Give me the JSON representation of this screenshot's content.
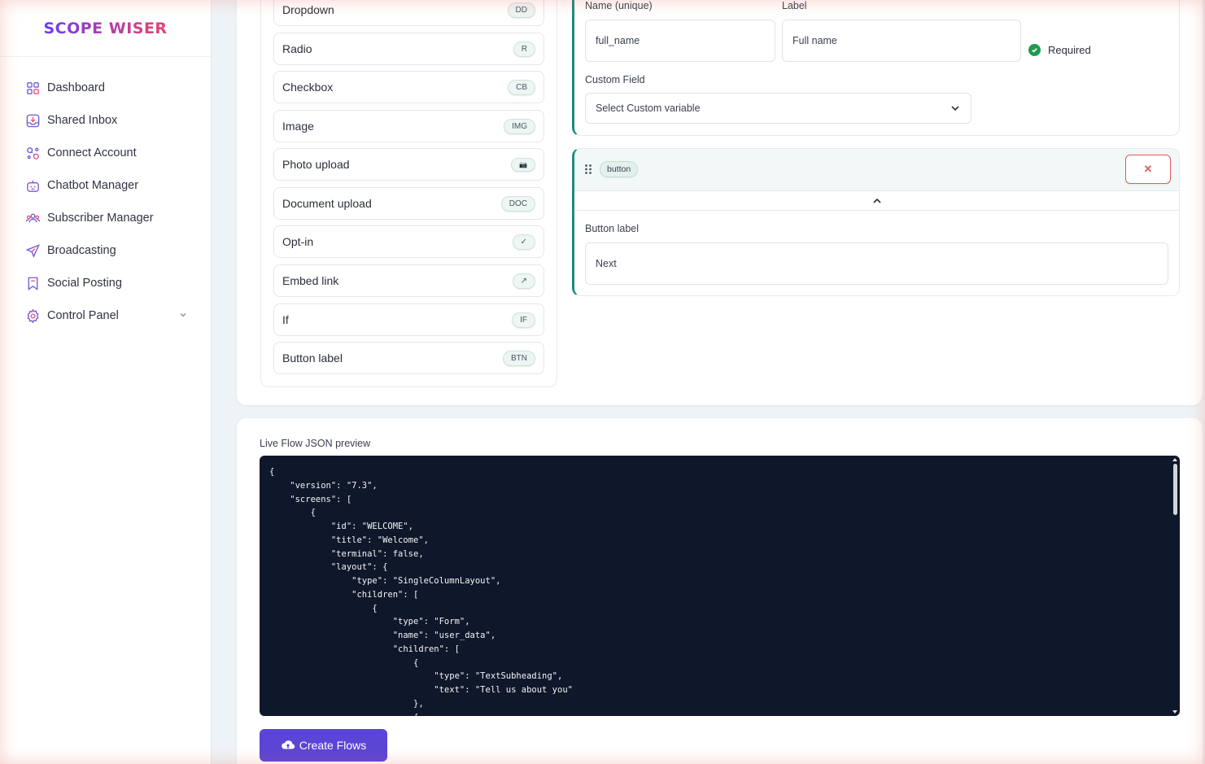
{
  "brand": {
    "logo_text": "SCOPE WISER"
  },
  "sidebar": {
    "items": [
      {
        "label": "Dashboard",
        "icon": "grid-icon"
      },
      {
        "label": "Shared Inbox",
        "icon": "inbox-icon"
      },
      {
        "label": "Connect Account",
        "icon": "link-icon"
      },
      {
        "label": "Chatbot Manager",
        "icon": "bot-icon"
      },
      {
        "label": "Subscriber Manager",
        "icon": "users-icon"
      },
      {
        "label": "Broadcasting",
        "icon": "send-icon"
      },
      {
        "label": "Social Posting",
        "icon": "bookmark-icon"
      },
      {
        "label": "Control Panel",
        "icon": "gear-icon",
        "has_chevron": true
      }
    ]
  },
  "palette": {
    "items": [
      {
        "label": "Dropdown",
        "badge": "DD"
      },
      {
        "label": "Radio",
        "badge": "R"
      },
      {
        "label": "Checkbox",
        "badge": "CB"
      },
      {
        "label": "Image",
        "badge": "IMG"
      },
      {
        "label": "Photo upload",
        "badge": "📷"
      },
      {
        "label": "Document upload",
        "badge": "DOC"
      },
      {
        "label": "Opt-in",
        "badge": "✓"
      },
      {
        "label": "Embed link",
        "badge": "↗"
      },
      {
        "label": "If",
        "badge": "IF"
      },
      {
        "label": "Button label",
        "badge": "BTN"
      }
    ]
  },
  "field_editor": {
    "name_label": "Name (unique)",
    "name_value": "full_name",
    "label_label": "Label",
    "label_value": "Full name",
    "required_text": "Required",
    "custom_field_label": "Custom Field",
    "custom_field_value": "Select Custom variable"
  },
  "button_editor": {
    "type_pill": "button",
    "delete_glyph": "✕",
    "button_label_label": "Button label",
    "button_label_value": "Next"
  },
  "json_preview": {
    "title": "Live Flow JSON preview",
    "code": "{\n    \"version\": \"7.3\",\n    \"screens\": [\n        {\n            \"id\": \"WELCOME\",\n            \"title\": \"Welcome\",\n            \"terminal\": false,\n            \"layout\": {\n                \"type\": \"SingleColumnLayout\",\n                \"children\": [\n                    {\n                        \"type\": \"Form\",\n                        \"name\": \"user_data\",\n                        \"children\": [\n                            {\n                                \"type\": \"TextSubheading\",\n                                \"text\": \"Tell us about you\"\n                            },\n                            {"
  },
  "actions": {
    "create_label": "Create Flows"
  },
  "colors": {
    "accent": "#5b45d6",
    "teal": "#1f8a7d",
    "code_bg": "#0f172a",
    "danger": "#e35d5d"
  }
}
